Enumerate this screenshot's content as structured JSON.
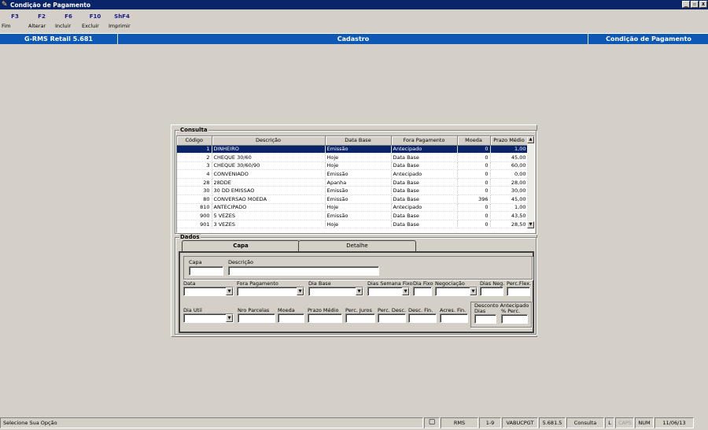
{
  "window": {
    "title": "Condição de Pagamento",
    "buttons": [
      "_",
      "▫",
      "x"
    ]
  },
  "toolbar": [
    {
      "key": "F3",
      "label": "Fim"
    },
    {
      "key": "F2",
      "label": "Alterar"
    },
    {
      "key": "F6",
      "label": "Incluir"
    },
    {
      "key": "F10",
      "label": "Excluir"
    },
    {
      "key": "ShF4",
      "label": "Imprimir"
    }
  ],
  "header": {
    "product": "G-RMS Retail 5.681",
    "section": "Cadastro",
    "screen": "Condição de Pagamento"
  },
  "consulta": {
    "title": "Consulta",
    "columns": [
      "Código",
      "Descrição",
      "Data Base",
      "Fora Pagamento",
      "Moeda",
      "Prazo Médio"
    ],
    "rows": [
      [
        "1",
        "DINHEIRO",
        "Emissão",
        "Antecipado",
        "0",
        "1,00"
      ],
      [
        "2",
        "CHEQUE 30/60",
        "Hoje",
        "Data Base",
        "0",
        "45,00"
      ],
      [
        "3",
        "CHEQUE 30/60/90",
        "Hoje",
        "Data Base",
        "0",
        "60,00"
      ],
      [
        "4",
        "CONVENIADO",
        "Emissão",
        "Antecipado",
        "0",
        "0,00"
      ],
      [
        "28",
        "28DDE",
        "Apanha",
        "Data Base",
        "0",
        "28,00"
      ],
      [
        "30",
        "30 DD EMISSAO",
        "Emissão",
        "Data Base",
        "0",
        "30,00"
      ],
      [
        "80",
        "CONVERSAO MOEDA",
        "Emissão",
        "Data Base",
        "396",
        "45,00"
      ],
      [
        "810",
        "ANTECIPADO",
        "Hoje",
        "Antecipado",
        "0",
        "1,00"
      ],
      [
        "900",
        "5 VEZES",
        "Emissão",
        "Data Base",
        "0",
        "43,50"
      ],
      [
        "901",
        "3 VEZES",
        "Hoje",
        "Data Base",
        "0",
        "28,50"
      ]
    ]
  },
  "dados": {
    "title": "Dados",
    "tabs": [
      "Capa",
      "Detalhe"
    ],
    "labels": {
      "capa": "Capa",
      "descricao": "Descrição",
      "data": "Data",
      "fora_pagamento": "Fora Pagamento",
      "dia_base": "Dia Base",
      "dias_semana_fixo": "Dias Semana Fixo",
      "dia_fixo": "Dia Fixo",
      "negociacao": "Negociação",
      "dias_neg": "Dias Neg.",
      "perc_flex": "Perc.Flex.",
      "dia_util": "Dia Util",
      "nro_parcelas": "Nro Parcelas",
      "moeda": "Moeda",
      "prazo_medio": "Prazo Médio",
      "perc_juros": "Perc. Juros",
      "perc_desc": "Perc. Desc.",
      "desc_fin": "Desc. Fin.",
      "acres_fin": "Acres. Fin.",
      "desconto_antecipado": "Desconto Antecipado",
      "dias": "Dias",
      "perc_perc": "% Perc."
    }
  },
  "status": {
    "message": "Selecione Sua Opção",
    "user": "RMS",
    "range": "1-9",
    "program": "VABUCPGT",
    "version": "5.681.5",
    "mode": "Consulta",
    "l": "L",
    "caps": "CAPS",
    "num": "NUM",
    "date": "11/06/13"
  }
}
